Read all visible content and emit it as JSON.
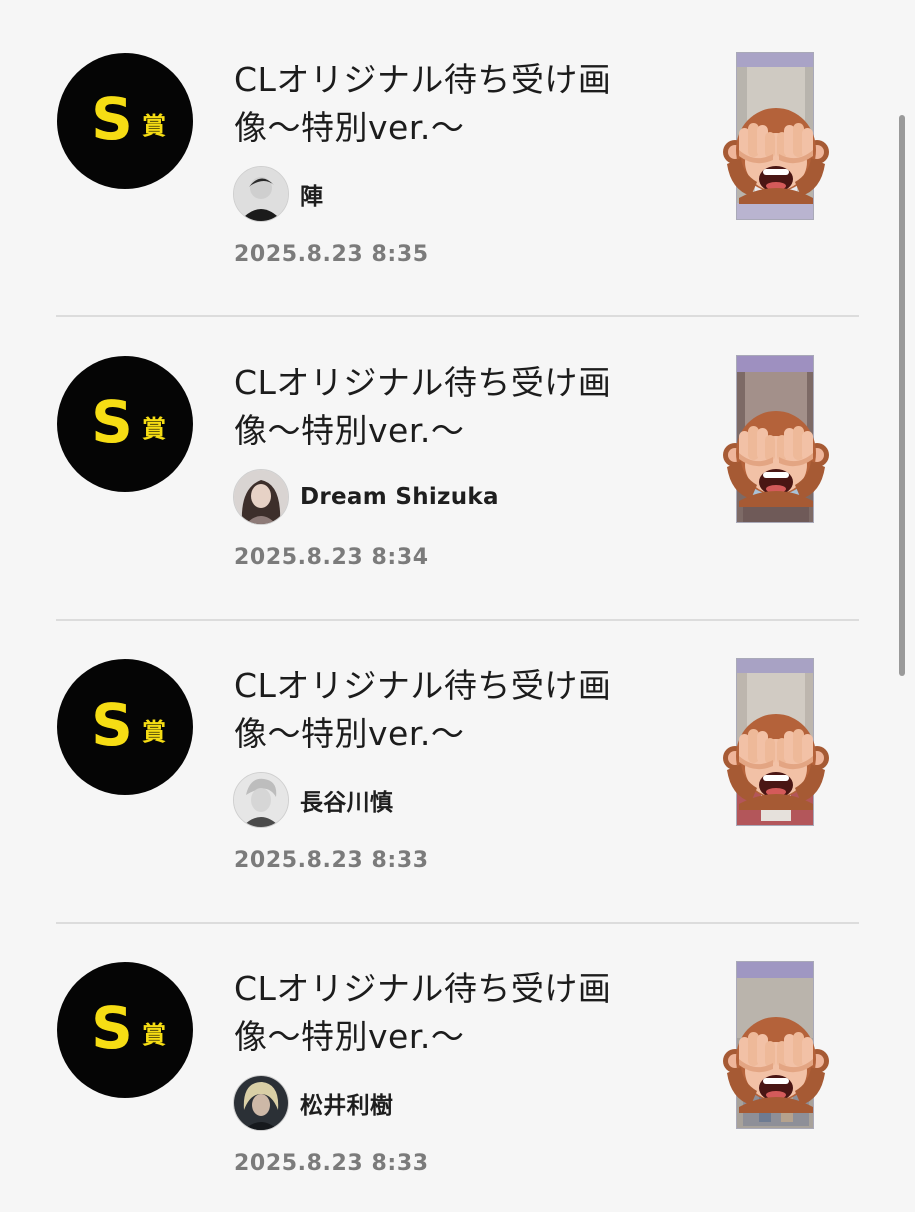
{
  "badge": {
    "letter": "S",
    "kanji": "賞",
    "icon": "s-prize-badge-icon",
    "background_color": "#050505",
    "text_color": "#f6dd14"
  },
  "items": [
    {
      "title": "CLオリジナル待ち受け画像〜特別ver.〜",
      "author": "陣",
      "date": "2025.8.23 8:35",
      "thumbnail_icon": "see-no-evil-monkey-icon"
    },
    {
      "title": "CLオリジナル待ち受け画像〜特別ver.〜",
      "author": "Dream Shizuka",
      "date": "2025.8.23 8:34",
      "thumbnail_icon": "see-no-evil-monkey-icon"
    },
    {
      "title": "CLオリジナル待ち受け画像〜特別ver.〜",
      "author": "長谷川慎",
      "date": "2025.8.23 8:33",
      "thumbnail_icon": "see-no-evil-monkey-icon"
    },
    {
      "title": "CLオリジナル待ち受け画像〜特別ver.〜",
      "author": "松井利樹",
      "date": "2025.8.23 8:33",
      "thumbnail_icon": "see-no-evil-monkey-icon"
    }
  ]
}
